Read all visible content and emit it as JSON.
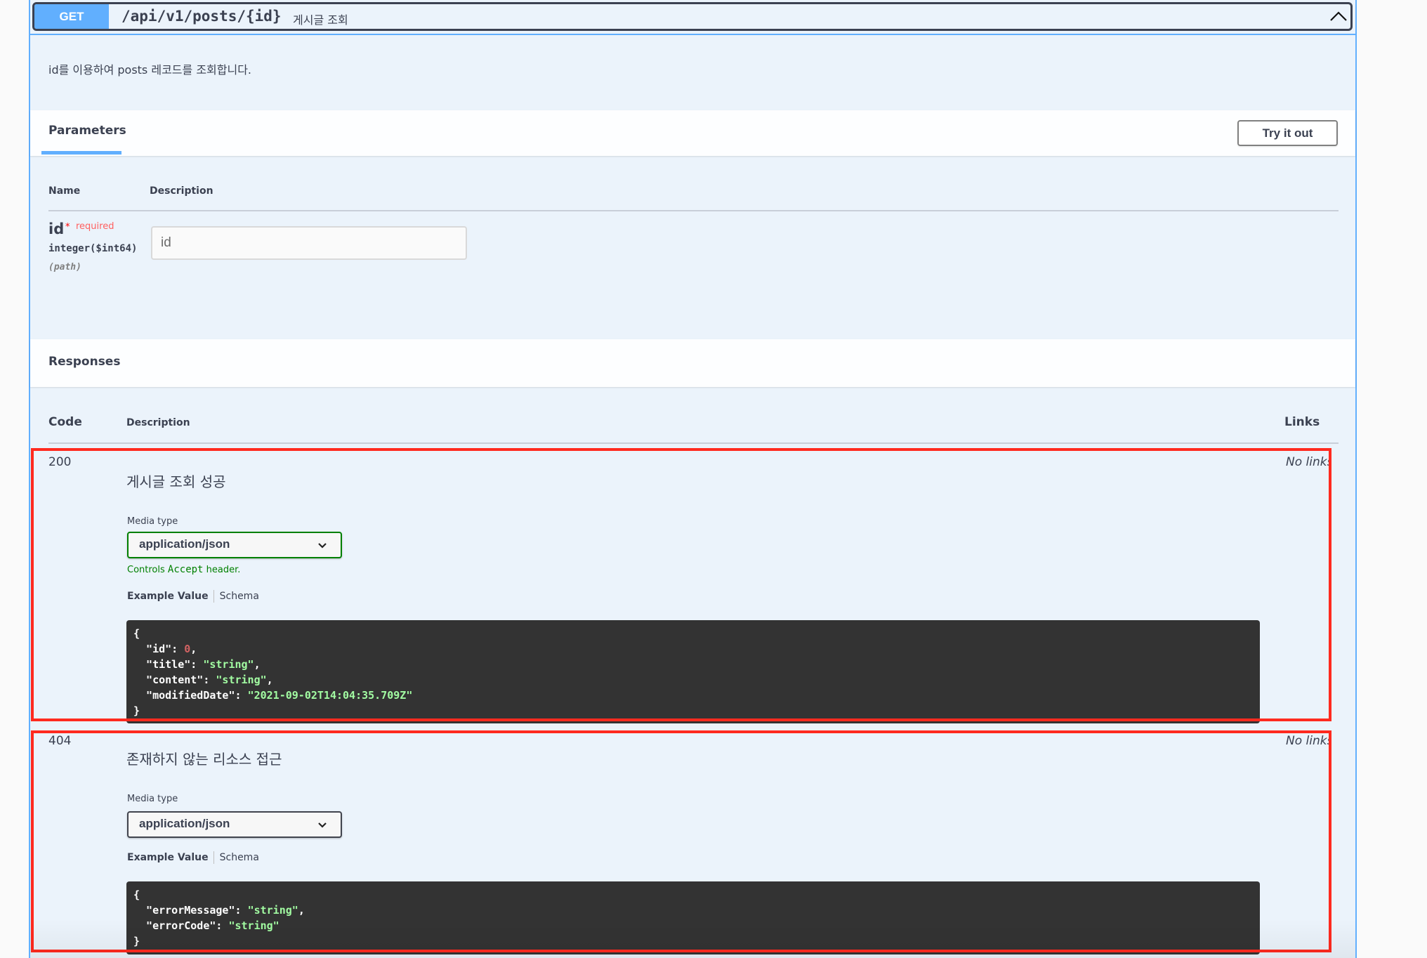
{
  "operation": {
    "method": "GET",
    "path": "/api/v1/posts/{id}",
    "summary": "게시글 조회",
    "description": "id를 이용하여 posts 레코드를 조회합니다.",
    "collapse_icon": "chevron-up-icon",
    "accent_color": "#61affe"
  },
  "parameters": {
    "tab_label": "Parameters",
    "try_it_out_label": "Try it out",
    "columns": {
      "name": "Name",
      "description": "Description"
    },
    "items": [
      {
        "name": "id",
        "required_star": "*",
        "required_label": "required",
        "type": "integer($int64)",
        "in": "(path)",
        "value": "",
        "placeholder": "id"
      }
    ]
  },
  "responses": {
    "title": "Responses",
    "columns": {
      "code": "Code",
      "description": "Description",
      "links": "Links"
    },
    "items": [
      {
        "code": "200",
        "description": "게시글 조회 성공",
        "links": "No links",
        "media_type_label": "Media type",
        "media_type": "application/json",
        "accept_note_prefix": "Controls ",
        "accept_note_code": "Accept",
        "accept_note_suffix": " header.",
        "example_tab": "Example Value",
        "schema_tab": "Schema",
        "example": {
          "open": "{",
          "lines": [
            {
              "key": "\"id\"",
              "value": "0",
              "kind": "num",
              "comma": ","
            },
            {
              "key": "\"title\"",
              "value": "\"string\"",
              "kind": "str",
              "comma": ","
            },
            {
              "key": "\"content\"",
              "value": "\"string\"",
              "kind": "str",
              "comma": ","
            },
            {
              "key": "\"modifiedDate\"",
              "value": "\"2021-09-02T14:04:35.709Z\"",
              "kind": "str",
              "comma": ""
            }
          ],
          "close": "}"
        }
      },
      {
        "code": "404",
        "description": "존재하지 않는 리소스 접근",
        "links": "No links",
        "media_type_label": "Media type",
        "media_type": "application/json",
        "example_tab": "Example Value",
        "schema_tab": "Schema",
        "example": {
          "open": "{",
          "lines": [
            {
              "key": "\"errorMessage\"",
              "value": "\"string\"",
              "kind": "str",
              "comma": ","
            },
            {
              "key": "\"errorCode\"",
              "value": "\"string\"",
              "kind": "str",
              "comma": ""
            }
          ],
          "close": "}"
        }
      }
    ]
  },
  "annotations": {
    "highlight_color": "#ff2a1f"
  }
}
